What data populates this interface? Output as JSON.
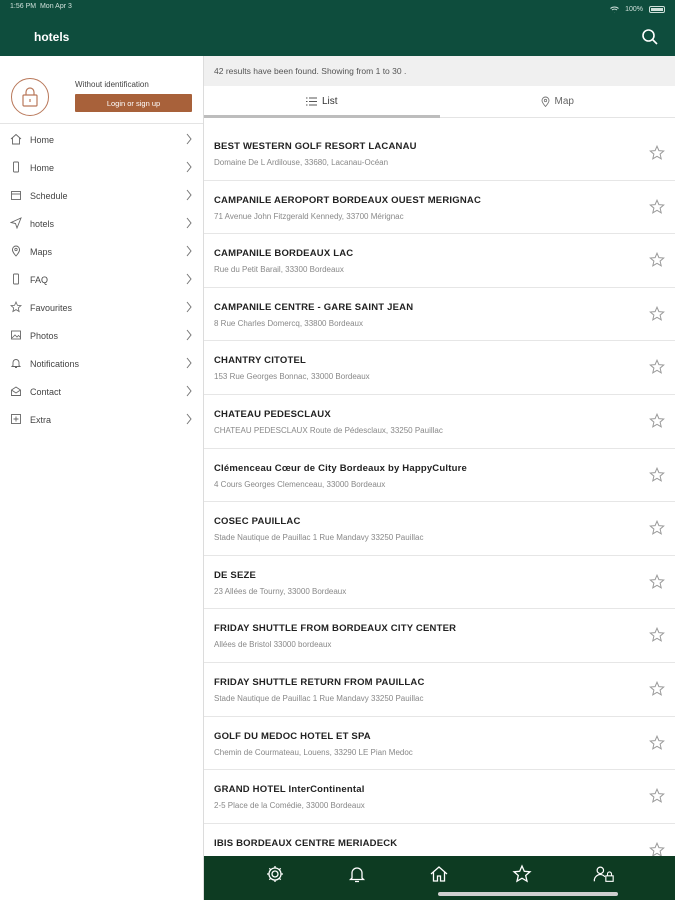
{
  "status_bar": {
    "time": "1:56 PM",
    "date": "Mon Apr 3",
    "battery": "100%"
  },
  "header": {
    "title": "hotels",
    "search_icon": "search-icon"
  },
  "user": {
    "identification": "Without identification",
    "login_label": "Login or sign up"
  },
  "sidebar": {
    "items": [
      {
        "label": "Home",
        "icon": "home-icon"
      },
      {
        "label": "Home",
        "icon": "phone-icon"
      },
      {
        "label": "Schedule",
        "icon": "calendar-icon"
      },
      {
        "label": "hotels",
        "icon": "send-icon"
      },
      {
        "label": "Maps",
        "icon": "pin-icon"
      },
      {
        "label": "FAQ",
        "icon": "phone-icon"
      },
      {
        "label": "Favourites",
        "icon": "star-icon"
      },
      {
        "label": "Photos",
        "icon": "image-icon"
      },
      {
        "label": "Notifications",
        "icon": "bell-icon"
      },
      {
        "label": "Contact",
        "icon": "mail-icon"
      },
      {
        "label": "Extra",
        "icon": "plus-icon"
      }
    ]
  },
  "results": {
    "summary": "42 results have been found. Showing from 1 to 30 ."
  },
  "tabs": {
    "list": "List",
    "map": "Map"
  },
  "hotels": [
    {
      "name": "BEST WESTERN GOLF RESORT LACANAU",
      "address": "Domaine De L Ardilouse, 33680, Lacanau-Océan"
    },
    {
      "name": "CAMPANILE AEROPORT BORDEAUX OUEST MERIGNAC",
      "address": "71 Avenue John Fitzgerald Kennedy, 33700 Mérignac"
    },
    {
      "name": "CAMPANILE BORDEAUX LAC",
      "address": "Rue du Petit Barail, 33300 Bordeaux"
    },
    {
      "name": "CAMPANILE CENTRE - GARE SAINT JEAN",
      "address": "8 Rue Charles Domercq, 33800 Bordeaux"
    },
    {
      "name": "CHANTRY CITOTEL",
      "address": "153 Rue Georges Bonnac, 33000 Bordeaux"
    },
    {
      "name": "CHATEAU PEDESCLAUX",
      "address": "CHATEAU PEDESCLAUX Route de Pédesclaux, 33250 Pauillac"
    },
    {
      "name": "Clémenceau Cœur de City Bordeaux by HappyCulture",
      "address": "4 Cours Georges Clemenceau, 33000 Bordeaux"
    },
    {
      "name": "COSEC PAUILLAC",
      "address": "Stade Nautique de Pauillac 1 Rue Mandavy 33250 Pauillac"
    },
    {
      "name": "DE SEZE",
      "address": "23 Allées de Tourny, 33000 Bordeaux"
    },
    {
      "name": "FRIDAY SHUTTLE FROM BORDEAUX CITY CENTER",
      "address": "Allées de Bristol 33000 bordeaux"
    },
    {
      "name": "FRIDAY SHUTTLE RETURN FROM PAUILLAC",
      "address": "Stade Nautique de Pauillac 1 Rue Mandavy 33250 Pauillac"
    },
    {
      "name": "GOLF DU MEDOC HOTEL ET SPA",
      "address": "Chemin de Courmateau, Louens, 33290 LE Pian Medoc"
    },
    {
      "name": "GRAND HOTEL InterContinental",
      "address": "2-5 Place de la Comédie, 33000 Bordeaux"
    },
    {
      "name": "IBIS BORDEAUX CENTRE MERIADECK",
      "address": ""
    }
  ],
  "bottom_nav": [
    {
      "icon": "settings-icon"
    },
    {
      "icon": "bell-icon"
    },
    {
      "icon": "home-icon"
    },
    {
      "icon": "star-icon"
    },
    {
      "icon": "user-lock-icon"
    }
  ],
  "colors": {
    "header": "#0e4d3d",
    "bottom_nav": "#0d3b22",
    "accent": "#a8613a"
  }
}
